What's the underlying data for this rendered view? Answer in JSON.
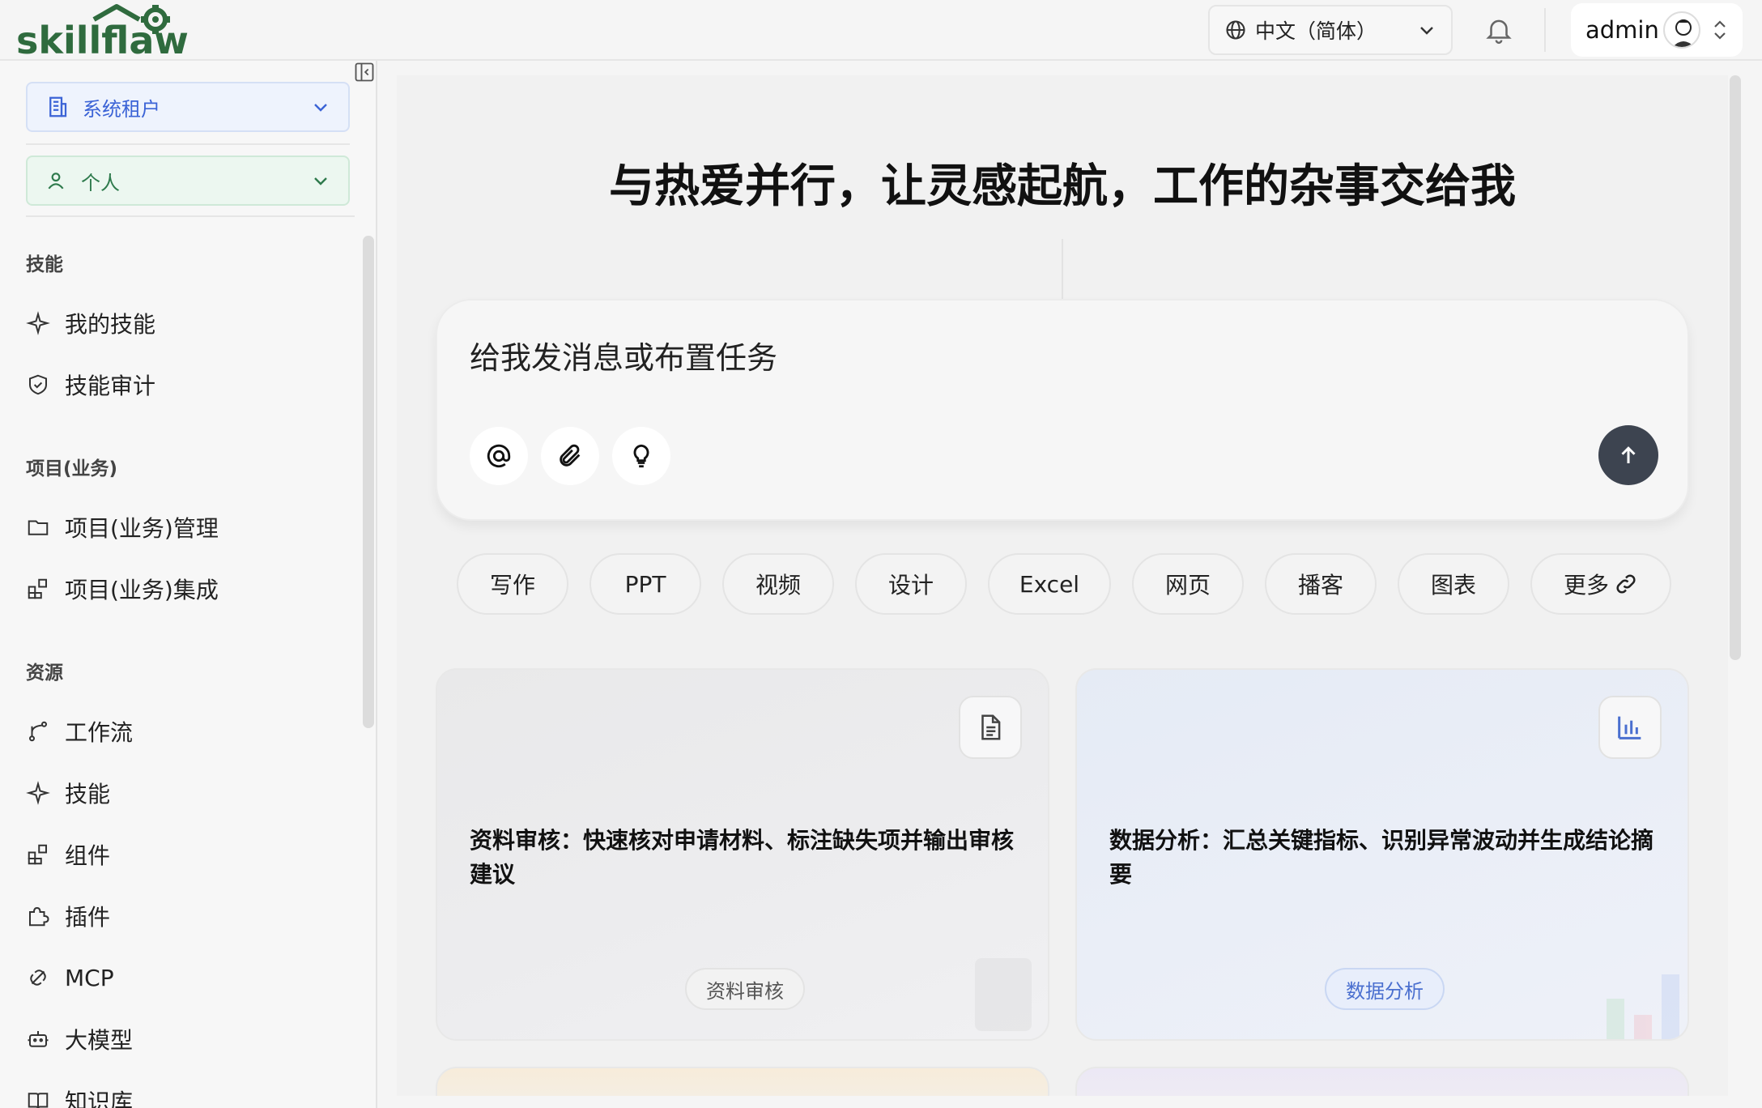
{
  "app": {
    "logo_text": "skillflaw",
    "language": "中文（简体）",
    "user_name": "admin"
  },
  "sidebar": {
    "tenant": "系统租户",
    "scope": "个人",
    "sections": [
      {
        "title": "技能",
        "items": [
          "我的技能",
          "技能审计"
        ]
      },
      {
        "title": "项目(业务)",
        "items": [
          "项目(业务)管理",
          "项目(业务)集成"
        ]
      },
      {
        "title": "资源",
        "items": [
          "工作流",
          "技能",
          "组件",
          "插件",
          "MCP",
          "大模型",
          "知识库"
        ]
      }
    ]
  },
  "main": {
    "headline": "与热爱并行，让灵感起航，工作的杂事交给我",
    "input_placeholder": "给我发消息或布置任务",
    "chips": [
      "写作",
      "PPT",
      "视频",
      "设计",
      "Excel",
      "网页",
      "播客",
      "图表",
      "更多"
    ],
    "cards": [
      {
        "title": "资料审核：快速核对申请材料、标注缺失项并输出审核建议",
        "tag": "资料审核",
        "icon": "document-icon"
      },
      {
        "title": "数据分析：汇总关键指标、识别异常波动并生成结论摘要",
        "tag": "数据分析",
        "icon": "bar-chart-icon"
      }
    ]
  },
  "colors": {
    "accent_blue": "#3b63d6",
    "accent_green": "#2e7a4c",
    "send_button": "#3d4450"
  }
}
